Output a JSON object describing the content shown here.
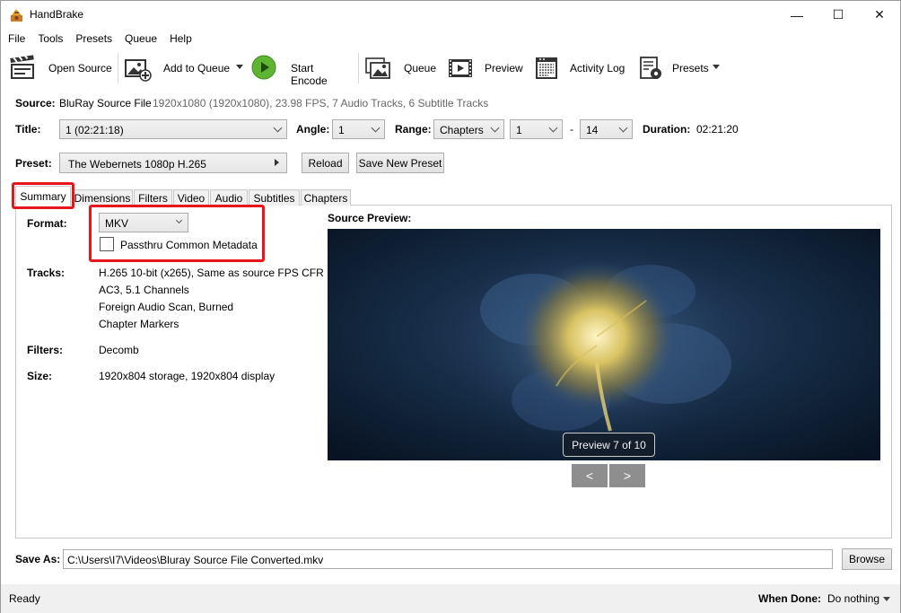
{
  "window": {
    "title": "HandBrake",
    "minimize": "—",
    "maximize": "☐",
    "close": "✕"
  },
  "menu": [
    "File",
    "Tools",
    "Presets",
    "Queue",
    "Help"
  ],
  "toolbar": {
    "open_source": "Open Source",
    "add_to_queue": "Add to Queue",
    "start_encode": "Start Encode",
    "queue": "Queue",
    "preview": "Preview",
    "activity_log": "Activity Log",
    "presets": "Presets"
  },
  "source": {
    "label": "Source:",
    "name": "BluRay Source File",
    "details": "1920x1080 (1920x1080), 23.98 FPS, 7 Audio Tracks, 6 Subtitle Tracks"
  },
  "title_row": {
    "title_label": "Title:",
    "title_value": "1  (02:21:18)",
    "angle_label": "Angle:",
    "angle_value": "1",
    "range_label": "Range:",
    "range_value": "Chapters",
    "range_start": "1",
    "range_dash": "-",
    "range_end": "14",
    "duration_label": "Duration:",
    "duration_value": "02:21:20"
  },
  "preset_row": {
    "label": "Preset:",
    "value": "The Webernets 1080p H.265",
    "reload": "Reload",
    "save_new": "Save New Preset"
  },
  "tabs": [
    "Summary",
    "Dimensions",
    "Filters",
    "Video",
    "Audio",
    "Subtitles",
    "Chapters"
  ],
  "summary": {
    "format_label": "Format:",
    "format_value": "MKV",
    "passthru_label": "Passthru Common Metadata",
    "passthru_checked": false,
    "tracks_label": "Tracks:",
    "tracks": [
      "H.265 10-bit (x265), Same as source FPS CFR",
      "AC3, 5.1 Channels",
      "Foreign Audio Scan, Burned",
      "Chapter Markers"
    ],
    "filters_label": "Filters:",
    "filters_value": "Decomb",
    "size_label": "Size:",
    "size_value": "1920x804 storage, 1920x804 display",
    "preview_label": "Source Preview:",
    "preview_badge": "Preview 7 of 10",
    "prev_button": "<",
    "next_button": ">"
  },
  "save_as": {
    "label": "Save As:",
    "value": "C:\\Users\\I7\\Videos\\Bluray Source File Converted.mkv",
    "browse": "Browse"
  },
  "status": {
    "text": "Ready",
    "when_done_label": "When Done:",
    "when_done_value": "Do nothing"
  },
  "colors": {
    "highlight": "#e8161c",
    "play_green": "#5fb532"
  }
}
